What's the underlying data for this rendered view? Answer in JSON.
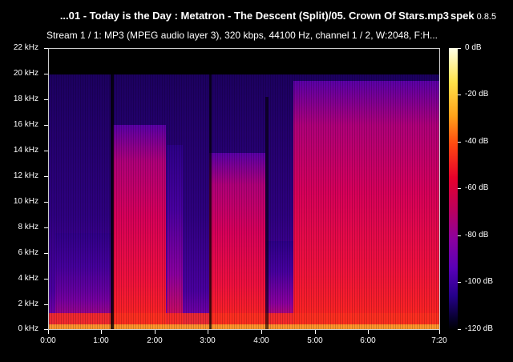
{
  "header": {
    "file_title": "...01 - Today is the Day : Metatron - The Descent (Split)/05. Crown Of Stars.mp3",
    "app_name": "spek",
    "app_version": "0.8.5",
    "stream_info": "Stream 1 / 1: MP3 (MPEG audio layer 3), 320 kbps, 44100 Hz, channel 1 / 2, W:2048, F:H..."
  },
  "frequency_axis": [
    "22 kHz",
    "20 kHz",
    "18 kHz",
    "16 kHz",
    "14 kHz",
    "12 kHz",
    "10 kHz",
    "8 kHz",
    "6 kHz",
    "4 kHz",
    "2 kHz",
    "0 kHz"
  ],
  "time_axis": [
    "0:00",
    "1:00",
    "2:00",
    "3:00",
    "4:00",
    "5:00",
    "6:00",
    "7:20"
  ],
  "db_scale": [
    "0 dB",
    "-20 dB",
    "-40 dB",
    "-60 dB",
    "-80 dB",
    "-100 dB",
    "-120 dB"
  ],
  "colors": {
    "background": "#000000",
    "loud": "#ff2a1a",
    "mid": "#c8006a",
    "quiet": "#2a0078",
    "silent": "#000000"
  }
}
